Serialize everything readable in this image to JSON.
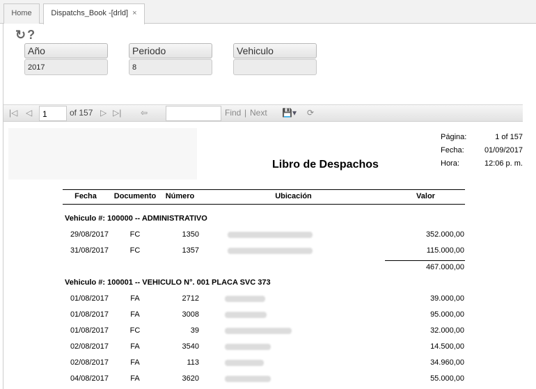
{
  "tabs": {
    "home": "Home",
    "active": "Dispatchs_Book -[drld]",
    "close": "×"
  },
  "params": {
    "year_label": "Año",
    "year_value": "2017",
    "period_label": "Periodo",
    "period_value": "8",
    "vehicle_label": "Vehiculo",
    "vehicle_value": ""
  },
  "toolbar": {
    "page": "1",
    "of_label": "of 157",
    "find": "Find",
    "sep": "|",
    "next": "Next"
  },
  "report": {
    "title": "Libro de Despachos",
    "pagina_label": "Página:",
    "pagina_value": "1 of 157",
    "fecha_label": "Fecha:",
    "fecha_value": "01/09/2017",
    "hora_label": "Hora:",
    "hora_value": "12:06 p. m.",
    "columns": {
      "fecha": "Fecha",
      "documento": "Documento",
      "numero": "Número",
      "ubicacion": "Ubicación",
      "valor": "Valor"
    },
    "group1": {
      "title": "Vehiculo #: 100000  --  ADMINISTRATIVO",
      "subtotal": "467.000,00",
      "rows": [
        {
          "fecha": "29/08/2017",
          "doc": "FC",
          "num": "1350",
          "valor": "352.000,00"
        },
        {
          "fecha": "31/08/2017",
          "doc": "FC",
          "num": "1357",
          "valor": "115.000,00"
        }
      ]
    },
    "group2": {
      "title": "Vehiculo #: 100001  --  VEHICULO N°. 001 PLACA SVC 373",
      "rows": [
        {
          "fecha": "01/08/2017",
          "doc": "FA",
          "num": "2712",
          "valor": "39.000,00"
        },
        {
          "fecha": "01/08/2017",
          "doc": "FA",
          "num": "3008",
          "valor": "95.000,00"
        },
        {
          "fecha": "01/08/2017",
          "doc": "FC",
          "num": "39",
          "valor": "32.000,00"
        },
        {
          "fecha": "02/08/2017",
          "doc": "FA",
          "num": "3540",
          "valor": "14.500,00"
        },
        {
          "fecha": "02/08/2017",
          "doc": "FA",
          "num": "113",
          "valor": "34.960,00"
        },
        {
          "fecha": "04/08/2017",
          "doc": "FA",
          "num": "3620",
          "valor": "55.000,00"
        }
      ]
    }
  }
}
